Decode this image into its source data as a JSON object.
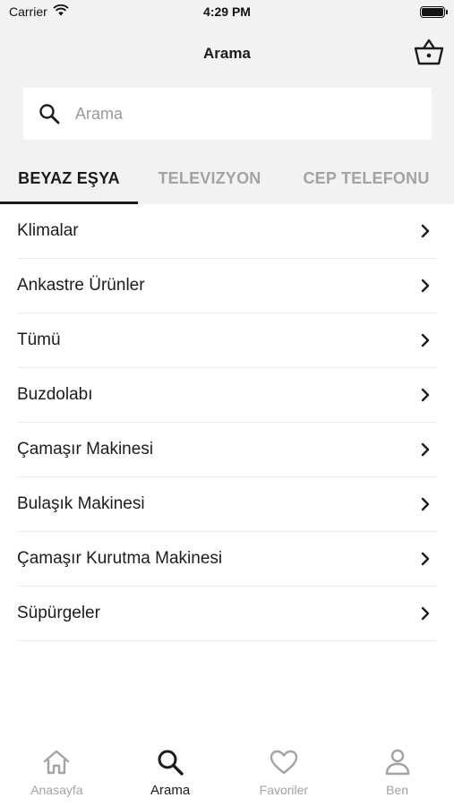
{
  "status": {
    "carrier": "Carrier",
    "time": "4:29 PM"
  },
  "nav": {
    "title": "Arama",
    "cart_icon": "basket-icon"
  },
  "search": {
    "placeholder": "Arama",
    "value": ""
  },
  "tabs": [
    {
      "label": "BEYAZ EŞYA",
      "active": true
    },
    {
      "label": "TELEVIZYON",
      "active": false
    },
    {
      "label": "CEP TELEFONU",
      "active": false
    }
  ],
  "categories": [
    {
      "label": "Klimalar"
    },
    {
      "label": "Ankastre Ürünler"
    },
    {
      "label": "Tümü"
    },
    {
      "label": "Buzdolabı"
    },
    {
      "label": "Çamaşır Makinesi"
    },
    {
      "label": "Bulaşık Makinesi"
    },
    {
      "label": "Çamaşır Kurutma Makinesi"
    },
    {
      "label": "Süpürgeler"
    }
  ],
  "tabbar": [
    {
      "label": "Anasayfa",
      "icon": "home-icon",
      "active": false
    },
    {
      "label": "Arama",
      "icon": "search-icon",
      "active": true
    },
    {
      "label": "Favoriler",
      "icon": "heart-icon",
      "active": false
    },
    {
      "label": "Ben",
      "icon": "person-icon",
      "active": false
    }
  ],
  "colors": {
    "active": "#1c1c1c",
    "inactive": "#a3a3a3",
    "header_bg": "#f2f2f2"
  }
}
